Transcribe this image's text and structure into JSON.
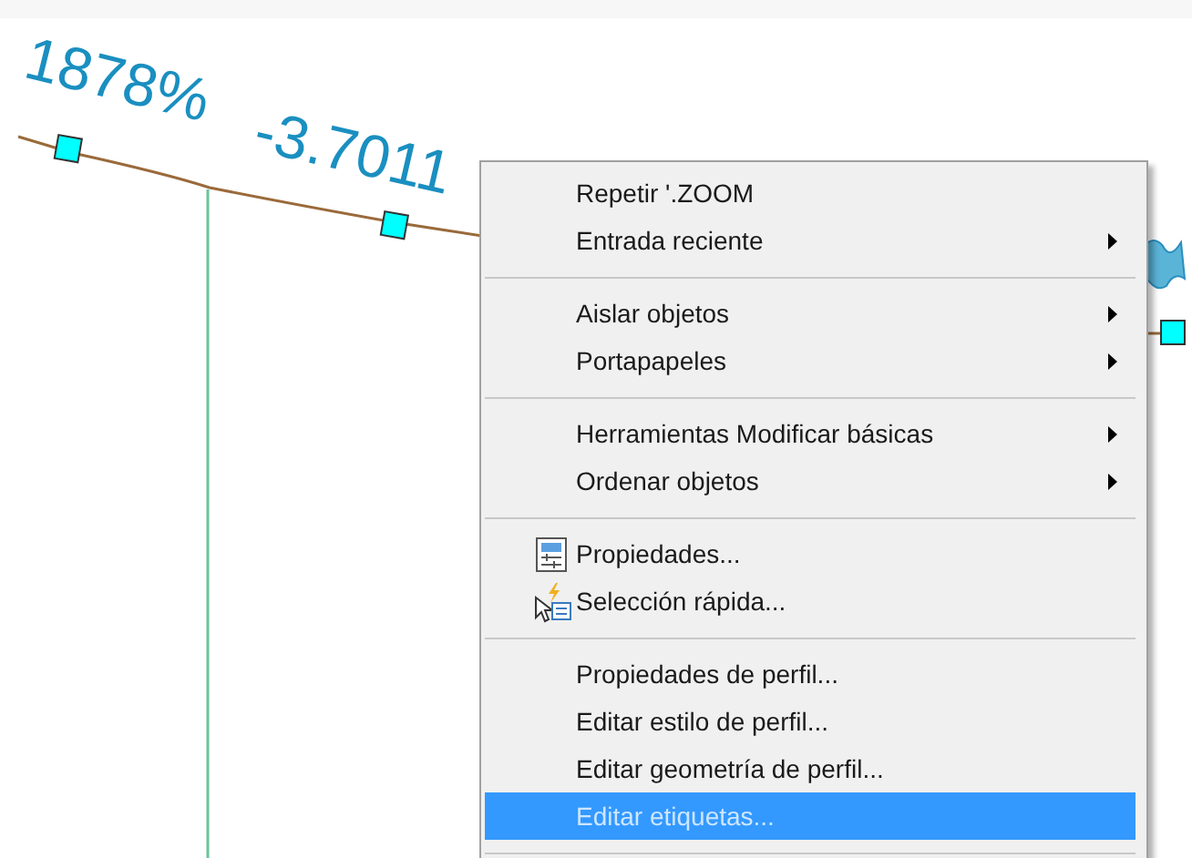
{
  "drawing": {
    "labels": [
      "1878%",
      "-3.7011"
    ]
  },
  "context_menu": {
    "items": [
      {
        "kind": "item",
        "label": "Repetir '.ZOOM",
        "submenu": false,
        "selected": false
      },
      {
        "kind": "item",
        "label": "Entrada reciente",
        "submenu": true,
        "selected": false
      },
      {
        "kind": "separator"
      },
      {
        "kind": "item",
        "label": "Aislar objetos",
        "submenu": true,
        "selected": false
      },
      {
        "kind": "item",
        "label": "Portapapeles",
        "submenu": true,
        "selected": false
      },
      {
        "kind": "separator"
      },
      {
        "kind": "item",
        "label": "Herramientas Modificar básicas",
        "submenu": true,
        "selected": false
      },
      {
        "kind": "item",
        "label": "Ordenar objetos",
        "submenu": true,
        "selected": false
      },
      {
        "kind": "separator"
      },
      {
        "kind": "properties",
        "label": "Propiedades...",
        "submenu": false,
        "selected": false
      },
      {
        "kind": "quickselect",
        "label": "Selección rápida...",
        "submenu": false,
        "selected": false
      },
      {
        "kind": "separator"
      },
      {
        "kind": "item",
        "label": "Propiedades de perfil...",
        "submenu": false,
        "selected": false
      },
      {
        "kind": "item",
        "label": "Editar estilo de perfil...",
        "submenu": false,
        "selected": false
      },
      {
        "kind": "item",
        "label": "Editar geometría de perfil...",
        "submenu": false,
        "selected": false
      },
      {
        "kind": "item",
        "label": "Editar etiquetas...",
        "submenu": false,
        "selected": true
      },
      {
        "kind": "separator"
      }
    ]
  }
}
